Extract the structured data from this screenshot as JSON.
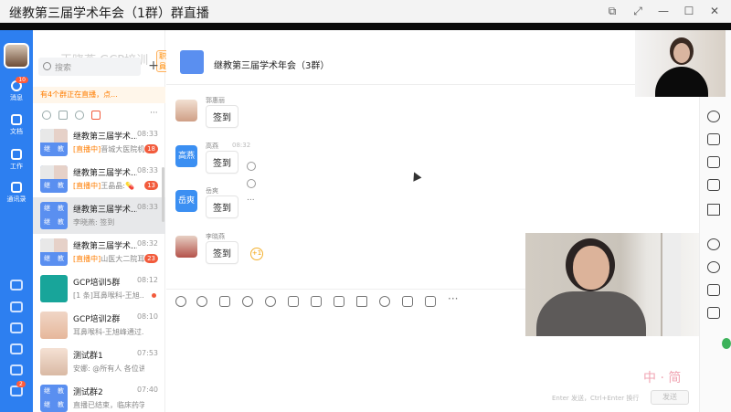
{
  "window": {
    "title": "继教第三届学术年会（1群）群直播",
    "controls": [
      "⧉",
      "⤢",
      "—",
      "☐",
      "✕"
    ]
  },
  "rail": {
    "items": [
      {
        "label": "消息",
        "badge": "10",
        "icon": "chat-icon"
      },
      {
        "label": "文档",
        "icon": "doc-icon"
      },
      {
        "label": "工作",
        "icon": "apps-icon"
      },
      {
        "label": "通讯录",
        "icon": "contacts-icon"
      }
    ],
    "bottom_badge": "2"
  },
  "profile": {
    "name": "王晓燕 GCP培训",
    "tag": "职員"
  },
  "search": {
    "placeholder": "搜索",
    "add": "+"
  },
  "live_notice": "有4个群正在直播，点...",
  "filters_more": "···",
  "conversations": [
    {
      "name": "继教第三届学术...",
      "time": "08:33",
      "live": "[直播中]",
      "preview": "晋城大医院机...",
      "badge": "18",
      "av": [
        "继",
        "教",
        "继",
        "教"
      ]
    },
    {
      "name": "继教第三届学术...",
      "time": "08:33",
      "live": "[直播中]",
      "preview": "王晶晶:💊",
      "badge": "13",
      "av": [
        "继",
        "教",
        "学",
        "术"
      ]
    },
    {
      "name": "继教第三届学术...",
      "time": "08:33",
      "live": "",
      "preview": "李晓燕: 签到",
      "badge": "",
      "av": [
        "继",
        "教",
        "继",
        "教"
      ]
    },
    {
      "name": "继教第三届学术...",
      "time": "08:32",
      "live": "[直播中]",
      "preview": "山医大二院耳...",
      "badge": "23",
      "av": [
        "继",
        "教",
        "学",
        "术"
      ]
    },
    {
      "name": "GCP培训5群",
      "time": "08:12",
      "live": "",
      "preview": "[1 条]耳鼻喉科-王旭...",
      "badge": "•",
      "av": [
        "",
        "",
        "",
        ""
      ]
    },
    {
      "name": "GCP培训2群",
      "time": "08:10",
      "live": "",
      "preview": "耳鼻喉科-王旭峰通过...",
      "badge": "",
      "av": [
        "",
        "",
        "",
        ""
      ]
    },
    {
      "name": "测试群1",
      "time": "07:53",
      "live": "",
      "preview": "安娜: @所有人 各位讲...",
      "badge": "",
      "av": [
        "",
        "",
        "",
        ""
      ]
    },
    {
      "name": "测试群2",
      "time": "07:40",
      "live": "",
      "preview": "直播已结束，临床药学...",
      "badge": "",
      "av": [
        "继",
        "教",
        "继",
        "教"
      ]
    }
  ],
  "chat": {
    "title": "继教第三届学术年会（3群）",
    "messages": [
      {
        "name": "郭惠丽",
        "time": "",
        "text": "签到",
        "av_text": ""
      },
      {
        "name": "高燕",
        "time": "08:32",
        "text": "签到",
        "av_text": "高燕"
      },
      {
        "name": "岳爽",
        "time": "",
        "text": "签到",
        "av_text": "岳爽"
      },
      {
        "name": "李晓燕",
        "time": "",
        "text": "签到",
        "av_text": ""
      }
    ],
    "plus_one": "+1",
    "msg_more": "···",
    "hint": "Enter 发送，Ctrl+Enter 换行",
    "send": "发送",
    "ime": "中 · 简",
    "toolbar_more": "···"
  }
}
